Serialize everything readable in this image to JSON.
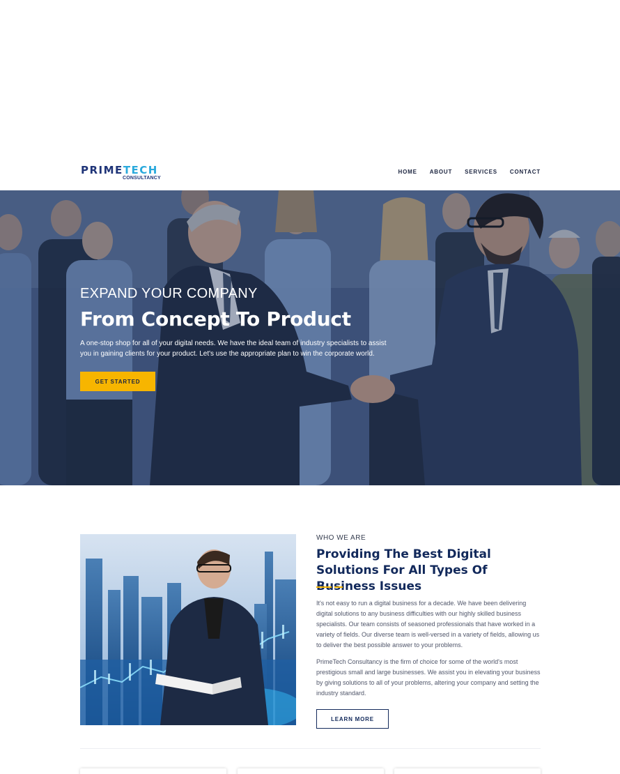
{
  "header": {
    "logo": {
      "main_part1": "PRIME",
      "main_part2": "TECH",
      "sub": "CONSULTANCY"
    },
    "nav": [
      "HOME",
      "ABOUT",
      "SERVICES",
      "CONTACT"
    ]
  },
  "hero": {
    "eyebrow": "EXPAND YOUR COMPANY",
    "title": "From Concept To Product",
    "text": "A one-stop shop for all of your digital needs. We have the ideal team of industry specialists to assist you in gaining clients for your product. Let's use the appropriate plan to win the corporate world.",
    "button": "GET STARTED"
  },
  "about": {
    "eyebrow": "WHO WE ARE",
    "title": "Providing The Best Digital Solutions For All Types Of Business Issues",
    "paragraph1": "It's not easy to run a digital business for a decade. We have been delivering digital solutions to any business difficulties with our highly skilled business specialists. Our team consists of seasoned professionals that have worked in a variety of fields. Our diverse team is well-versed in a variety of fields, allowing us to deliver the best possible answer to your problems.",
    "paragraph2": "PrimeTech Consultancy is the firm of choice for some of the world's most prestigious small and large businesses. We assist you in elevating your business by giving solutions to all of your problems, altering your company and setting the industry standard.",
    "button": "LEARN MORE"
  },
  "colors": {
    "accent": "#f7b500",
    "brand_dark": "#12295b",
    "brand_light": "#2aa9dc"
  }
}
